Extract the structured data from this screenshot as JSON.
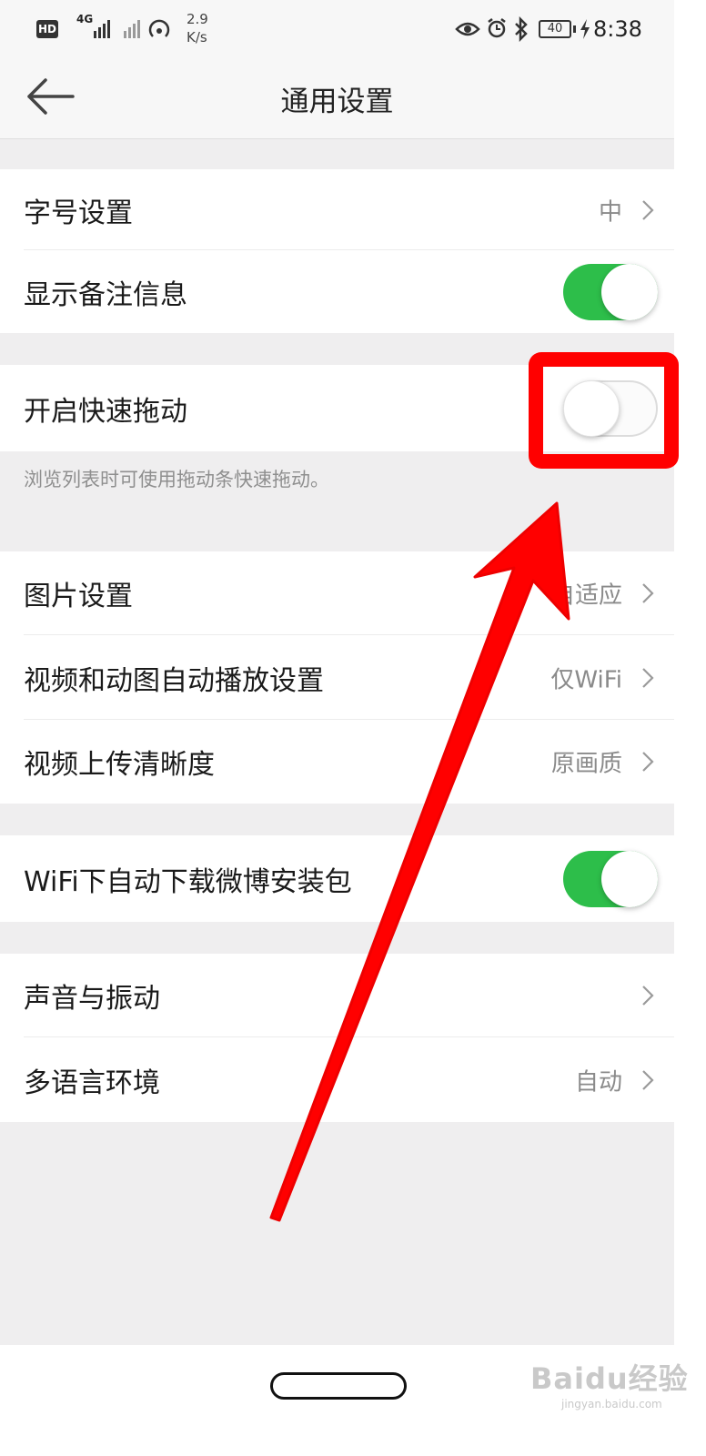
{
  "status_bar": {
    "hd": "HD",
    "net_type": "4G",
    "net_speed_value": "2.9",
    "net_speed_unit": "K/s",
    "battery": "40",
    "time": "8:38"
  },
  "header": {
    "title": "通用设置"
  },
  "settings": {
    "font_size": {
      "label": "字号设置",
      "value": "中"
    },
    "show_remark": {
      "label": "显示备注信息",
      "enabled": true
    },
    "fast_drag": {
      "label": "开启快速拖动",
      "enabled": false,
      "note": "浏览列表时可使用拖动条快速拖动。"
    },
    "image_settings": {
      "label": "图片设置",
      "value": "自适应"
    },
    "autoplay": {
      "label": "视频和动图自动播放设置",
      "value": "仅WiFi"
    },
    "upload_quality": {
      "label": "视频上传清晰度",
      "value": "原画质"
    },
    "wifi_download": {
      "label": "WiFi下自动下载微博安装包",
      "enabled": true
    },
    "sound": {
      "label": "声音与振动",
      "value": ""
    },
    "language": {
      "label": "多语言环境",
      "value": "自动"
    }
  },
  "watermark": {
    "main": "Baidu经验",
    "sub": "jingyan.baidu.com"
  },
  "colors": {
    "toggle_on": "#2dbe4a",
    "annotation": "#ff0000",
    "background": "#efeeef"
  }
}
